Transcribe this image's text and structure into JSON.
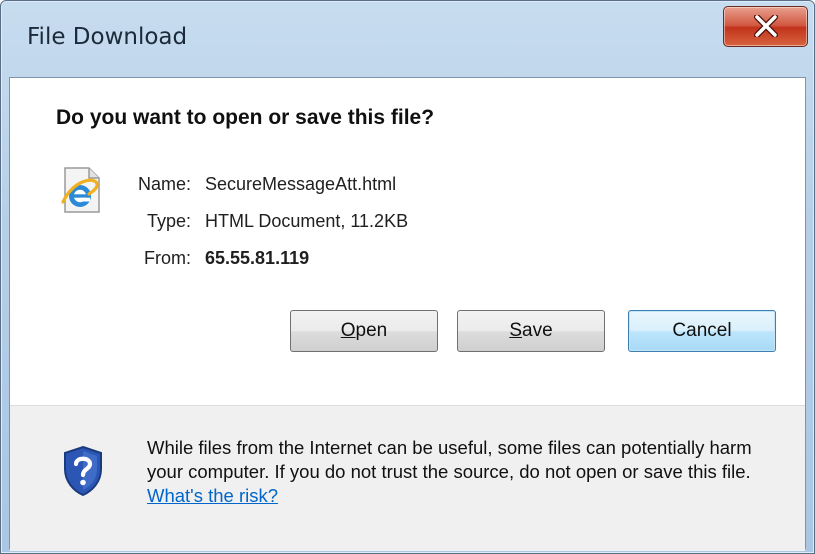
{
  "window": {
    "title": "File Download",
    "close_glyph": "X"
  },
  "prompt": {
    "question": "Do you want to open or save this file?"
  },
  "file": {
    "icon": "internet-explorer-html-file-icon",
    "name_label": "Name:",
    "name_value": "SecureMessageAtt.html",
    "type_label": "Type:",
    "type_value": "HTML Document, 11.2KB",
    "from_label": "From:",
    "from_value": "65.55.81.119"
  },
  "buttons": {
    "open": {
      "mnemonic": "O",
      "rest": "pen"
    },
    "save": {
      "mnemonic": "S",
      "rest": "ave"
    },
    "cancel": "Cancel"
  },
  "warning": {
    "icon": "shield-question-icon",
    "text": "While files from the Internet can be useful, some files can potentially harm your computer. If you do not trust the source, do not open or save this file.",
    "link_text": "What's the risk?"
  },
  "colors": {
    "link": "#0066cc",
    "close_button": "#c1331c",
    "default_button_border": "#3c7fb1",
    "shield_blue": "#2b56b3"
  }
}
